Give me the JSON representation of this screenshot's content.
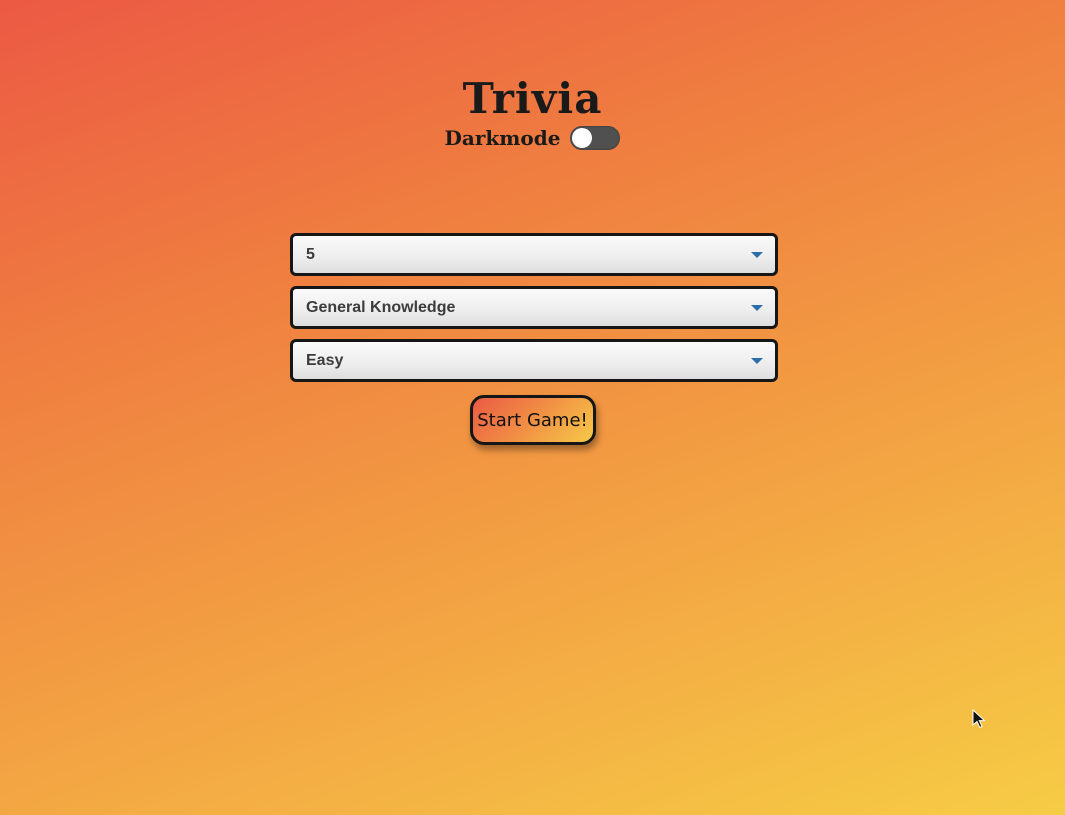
{
  "header": {
    "title": "Trivia",
    "darkmode_label": "Darkmode",
    "darkmode_on": false
  },
  "settings": {
    "question_count": {
      "value": "5"
    },
    "category": {
      "value": "General Knowledge"
    },
    "difficulty": {
      "value": "Easy"
    }
  },
  "actions": {
    "start_label": "Start Game!"
  },
  "icons": {
    "select_caret": "chevron-down-icon",
    "cursor": "mouse-pointer-icon"
  },
  "colors": {
    "caret": "#2b6ea8",
    "toggle_track": "#505050",
    "border": "#161616"
  }
}
